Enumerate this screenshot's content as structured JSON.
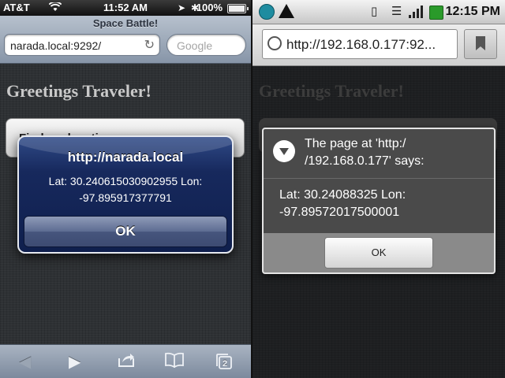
{
  "ios": {
    "status": {
      "carrier": "AT&T",
      "time": "11:52 AM",
      "battery": "100%"
    },
    "toolbar": {
      "title": "Space Battle!",
      "url": "narada.local:9292/",
      "search_placeholder": "Google"
    },
    "page": {
      "heading": "Greetings Traveler!",
      "find_button_label": "Find my location"
    },
    "alert": {
      "title": "http://narada.local",
      "message": "Lat: 30.240615030902955 Lon: -97.895917377791",
      "ok_label": "OK"
    },
    "bottom_bar": {
      "tabs_count": "2"
    }
  },
  "android": {
    "status": {
      "time": "12:15 PM"
    },
    "urlbar": {
      "url": "http://192.168.0.177:92..."
    },
    "page": {
      "heading": "Greetings Traveler!"
    },
    "dialog": {
      "title": "The page at 'http:/ /192.168.0.177' says:",
      "message": "Lat: 30.24088325 Lon: -97.89572017500001",
      "ok_label": "OK"
    }
  },
  "colors": {
    "ios_alert_blue": "#17295d",
    "ios_toolbar": "#8795a8",
    "android_dialog": "#4a4a4a",
    "page_background": "#2e3134"
  }
}
